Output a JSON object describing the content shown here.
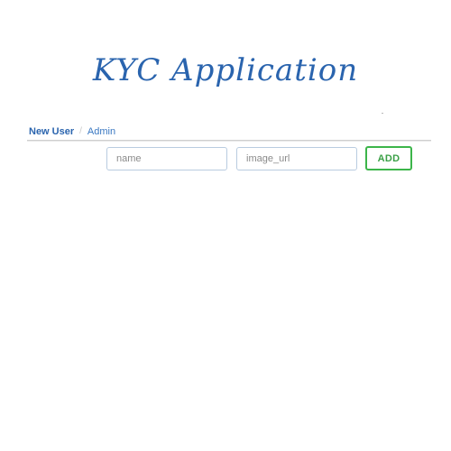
{
  "header": {
    "title": "KYC Application"
  },
  "breadcrumb": {
    "items": [
      {
        "label": "New User"
      },
      {
        "label": "Admin"
      }
    ],
    "separator": "/"
  },
  "form": {
    "name_field": {
      "value": "",
      "placeholder": "name"
    },
    "image_url_field": {
      "value": "",
      "placeholder": "image_url"
    },
    "add_label": "ADD"
  },
  "colors": {
    "title": "#2a64ae",
    "link": "#2a64ae",
    "add_button_border": "#3cb54a"
  }
}
